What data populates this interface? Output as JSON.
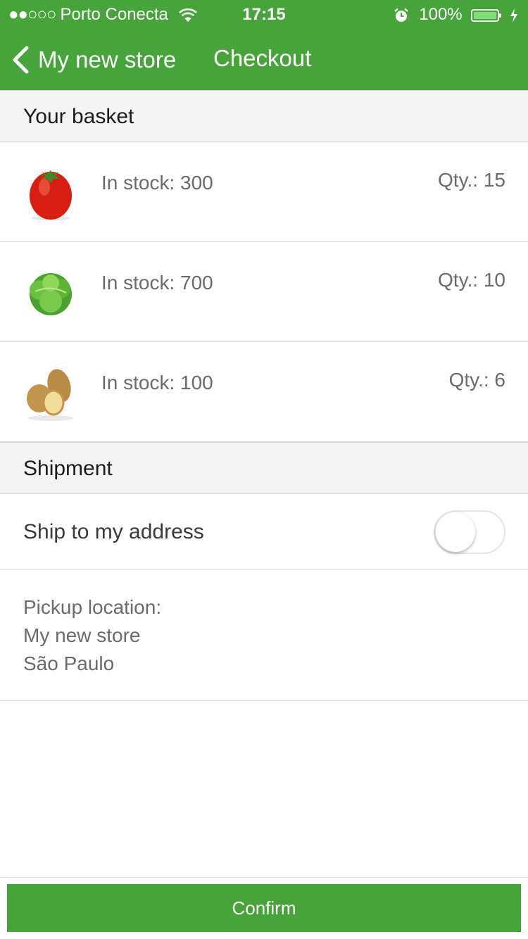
{
  "status_bar": {
    "carrier_dots": "●●○○○",
    "carrier": "Porto Conecta",
    "time": "17:15",
    "battery": "100%"
  },
  "nav": {
    "back_label": "My new store",
    "title": "Checkout"
  },
  "basket": {
    "header": "Your basket",
    "items": [
      {
        "image": "tomato",
        "stock": "In stock: 300",
        "qty": "Qty.: 15"
      },
      {
        "image": "lettuce",
        "stock": "In stock: 700",
        "qty": "Qty.: 10"
      },
      {
        "image": "potato",
        "stock": "In stock: 100",
        "qty": "Qty.: 6"
      }
    ]
  },
  "shipment": {
    "header": "Shipment",
    "ship_label": "Ship to my address",
    "ship_enabled": false,
    "pickup_lines": [
      "Pickup location:",
      "My new store",
      "São Paulo"
    ]
  },
  "confirm_label": "Confirm",
  "colors": {
    "brand_green": "#46a43a",
    "section_bg": "#f4f4f4",
    "divider": "#d8d8d8"
  }
}
